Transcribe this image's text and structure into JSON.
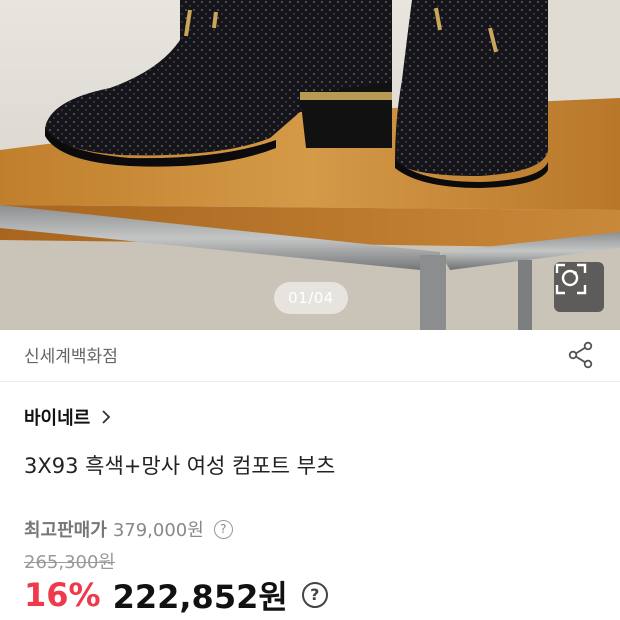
{
  "gallery": {
    "page_indicator": "01/04",
    "lens_icon": "camera-lens-search-icon"
  },
  "seller": {
    "name": "신세계백화점",
    "share_icon": "share-icon"
  },
  "product": {
    "brand": "바이네르",
    "brand_chevron": ">",
    "title": "3X93 흑색+망사 여성 컴포트 부츠"
  },
  "pricing": {
    "max_price_label": "최고판매가",
    "max_price_value": "379,000원",
    "original_price": "265,300원",
    "discount_rate": "16%",
    "sale_price": "222,852원",
    "help_glyph": "?"
  },
  "colors": {
    "discount_red": "#ee3a4a",
    "text_dark": "#111111",
    "text_muted": "#888888"
  }
}
